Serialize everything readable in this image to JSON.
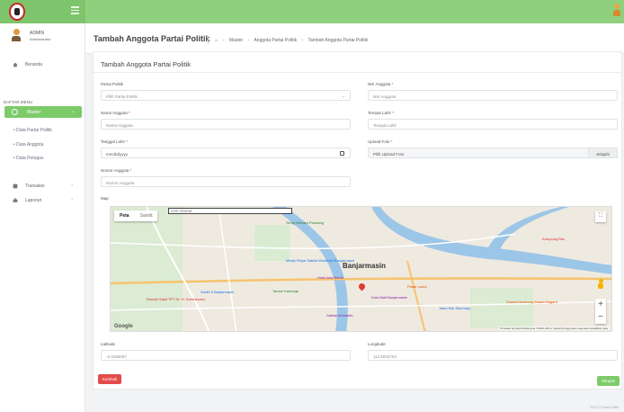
{
  "sidebar": {
    "user_name": "ADMIN",
    "user_role": "Administrator",
    "home_label": "Beranda",
    "section_label": "DAFTAR MENU",
    "master_label": "Master",
    "sub_items": [
      "Data Partai Politik",
      "Data Anggota",
      "Data Petugas"
    ],
    "transaksi_label": "Transaksi",
    "laporan_label": "Laporan"
  },
  "header": {
    "title": "Tambah Anggota Partai Politik",
    "breadcrumbs": [
      "Master",
      "Anggota Partai Politik",
      "Tambah Anggota Partai Politik"
    ]
  },
  "form": {
    "card_title": "Tambah Anggota Partai Politik",
    "partai": {
      "label": "Partai Politik",
      "value": "Pilih Partai Politik"
    },
    "nik": {
      "label": "NIK Anggota",
      "placeholder": "NIK Anggota"
    },
    "nama": {
      "label": "Nama Anggota",
      "placeholder": "Nama Anggota"
    },
    "tempat_lahir": {
      "label": "Tempat Lahir",
      "placeholder": "Tempat Lahir"
    },
    "tanggal_lahir": {
      "label": "Tanggal Lahir",
      "placeholder": "mm/dd/yyyy"
    },
    "foto": {
      "label": "Upload Foto",
      "placeholder": "Pilih Upload Foto",
      "button": "Jelajahi"
    },
    "nomor": {
      "label": "Nomor Anggota",
      "placeholder": "Nomor Anggota"
    },
    "map_label": "Map",
    "latitude": {
      "label": "Latitude",
      "value": "-3.3186097"
    },
    "longitude": {
      "label": "Longitude",
      "value": "114.5943784"
    },
    "back_button": "Kembali",
    "save_button": "Simpan"
  },
  "map": {
    "tab_map": "Peta",
    "tab_satellite": "Satelit",
    "search_placeholder": "Cari Alamat",
    "city": "Banjarmasin",
    "places": [
      "Mesjid Raya Sabilal Muhtadin Banjarmasin",
      "Rumah Sakit TPT Dr. H. Soeharsono",
      "Duta Mall Banjarmasin",
      "Hotel Aria Barito",
      "Taman Kamboja",
      "Jalan Mat Sidomary",
      "Grand Kecubung Muara Nagara",
      "Siring Menara Pandang",
      "Pasar Lama",
      "Gadih 5 Banjarmasin",
      "Sabilal Muhtadin",
      "Kampung Biru"
    ],
    "attribution": "Pintasan keyboard   Data peta ©2024   200 m   Syarat Penggunaan   Laporkan kesalahan peta",
    "logo_text": "Google"
  },
  "footer": {
    "text": "2024 © Partai Politik"
  }
}
